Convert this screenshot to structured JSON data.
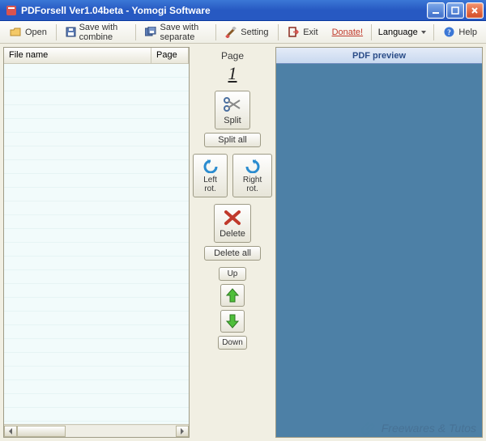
{
  "window": {
    "title": "PDForsell  Ver1.04beta - Yomogi Software"
  },
  "toolbar": {
    "open": "Open",
    "save_combine": "Save with combine",
    "save_separate": "Save with separate",
    "setting": "Setting",
    "exit": "Exit",
    "donate": "Donate!",
    "language": "Language",
    "help": "Help"
  },
  "filelist": {
    "col_filename": "File name",
    "col_page": "Page"
  },
  "page_indicator": {
    "label": "Page",
    "value": "1"
  },
  "tools": {
    "split": "Split",
    "split_all": "Split all",
    "left_rot": "Left rot.",
    "right_rot": "Right rot.",
    "delete": "Delete",
    "delete_all": "Delete all",
    "up": "Up",
    "down": "Down"
  },
  "preview": {
    "title": "PDF preview"
  },
  "watermark": "Freewares & Tutos"
}
